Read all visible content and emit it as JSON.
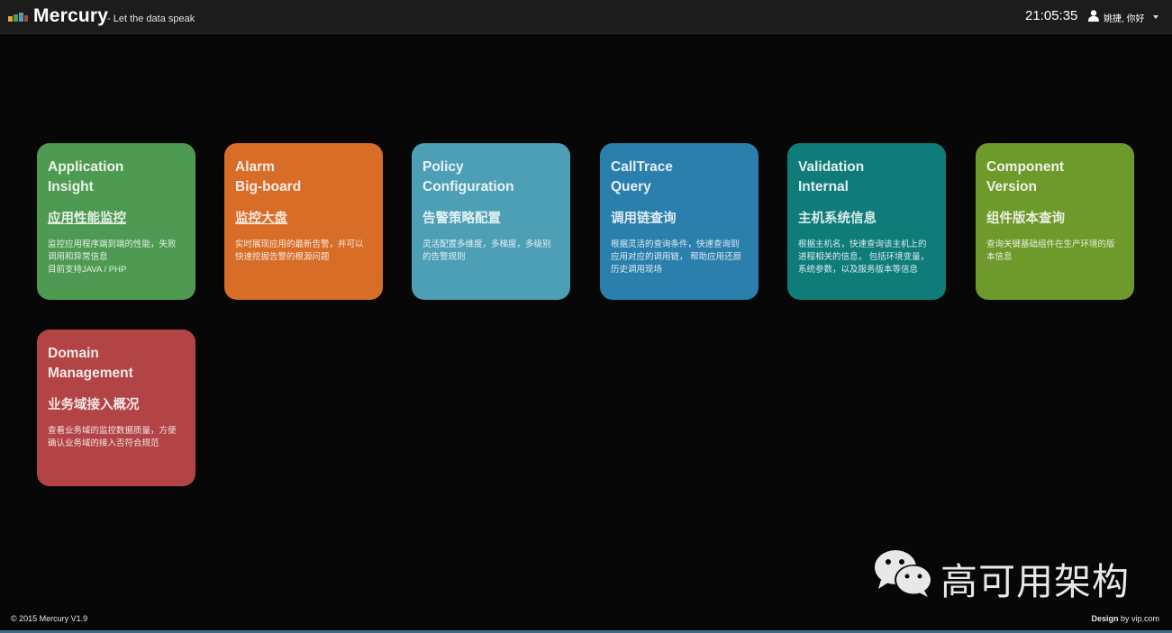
{
  "header": {
    "brand": "Mercury",
    "tagline": "- Let the data speak",
    "clock": "21:05:35",
    "user_greeting": "姚捷, 你好"
  },
  "tiles": [
    {
      "title": "Application\nInsight",
      "subtitle": "应用性能监控",
      "description": "监控应用程序端到端的性能，失败\n调用和异常信息\n目前支持JAVA / PHP",
      "color": "#4f9a52"
    },
    {
      "title": "Alarm\nBig-board",
      "subtitle": "监控大盘",
      "description": "实时展现应用的最新告警，并可以\n快速挖掘告警的根源问题",
      "color": "#d86d28"
    },
    {
      "title": "Policy\nConfiguration",
      "subtitle": "告警策略配置",
      "description": "灵活配置多维度，多梯度，多级别\n的告警规则",
      "color": "#4d9fb5"
    },
    {
      "title": "CallTrace\nQuery",
      "subtitle": "调用链查询",
      "description": "根据灵活的查询条件，快速查询到\n应用对应的调用链， 帮助应用还原\n历史调用现场",
      "color": "#2b7fac"
    },
    {
      "title": "Validation\nInternal",
      "subtitle": "主机系统信息",
      "description": "根据主机名，快速查询该主机上的\n进程相关的信息， 包括环境变量，\n系统参数，以及服务版本等信息",
      "color": "#0f7c7a"
    },
    {
      "title": "Component\nVersion",
      "subtitle": "组件版本查询",
      "description": "查询关键基础组件在生产环境的版\n本信息",
      "color": "#6e9a2c"
    },
    {
      "title": "Domain\nManagement",
      "subtitle": "业务域接入概况",
      "description": "查看业务域的监控数据质量，方便\n确认业务域的接入否符合规范",
      "color": "#b24446"
    }
  ],
  "footer": {
    "copyright": "© 2015 Mercury V1.9",
    "design_prefix": "Design",
    "design_suffix": " by vip.com"
  },
  "watermark": {
    "text": "高可用架构",
    "icon": "wechat-icon"
  }
}
